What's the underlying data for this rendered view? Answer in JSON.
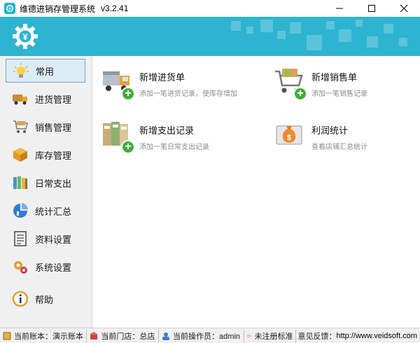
{
  "window": {
    "title": "维德进销存管理系统",
    "version": "v3.2.41",
    "controls": [
      "minimize",
      "maximize",
      "close"
    ]
  },
  "colors": {
    "accent": "#2db4d1",
    "active_bg": "#dcecf7",
    "plus_green": "#3fae3a"
  },
  "sidebar": {
    "items": [
      {
        "label": "常用",
        "icon": "lightbulb-icon",
        "active": true
      },
      {
        "label": "进货管理",
        "icon": "truck-icon",
        "active": false
      },
      {
        "label": "销售管理",
        "icon": "shopping-cart-icon",
        "active": false
      },
      {
        "label": "库存管理",
        "icon": "box-icon",
        "active": false
      },
      {
        "label": "日常支出",
        "icon": "binders-icon",
        "active": false
      },
      {
        "label": "统计汇总",
        "icon": "stats-icon",
        "active": false
      },
      {
        "label": "资料设置",
        "icon": "document-icon",
        "active": false
      },
      {
        "label": "系统设置",
        "icon": "gears-icon",
        "active": false
      },
      {
        "label": "帮助",
        "icon": "help-icon",
        "active": false
      }
    ]
  },
  "main": {
    "tiles": [
      {
        "title": "新增进货单",
        "subtitle": "添加一笔进货记录，使库存增加",
        "icon": "truck-add-icon"
      },
      {
        "title": "新增销售单",
        "subtitle": "添加一笔销售记录",
        "icon": "cart-add-icon"
      },
      {
        "title": "新增支出记录",
        "subtitle": "添加一笔日常支出记录",
        "icon": "binders-add-icon"
      },
      {
        "title": "利润统计",
        "subtitle": "查看店铺汇总统计",
        "icon": "money-bag-icon"
      }
    ]
  },
  "statusbar": {
    "account": "当前账本：演示账本",
    "store": "当前门店：总店",
    "operator": "当前操作员：admin",
    "unregistered": "未注册标准",
    "feedback": "意见反馈：",
    "website": "http://www.veidsoft.com"
  }
}
